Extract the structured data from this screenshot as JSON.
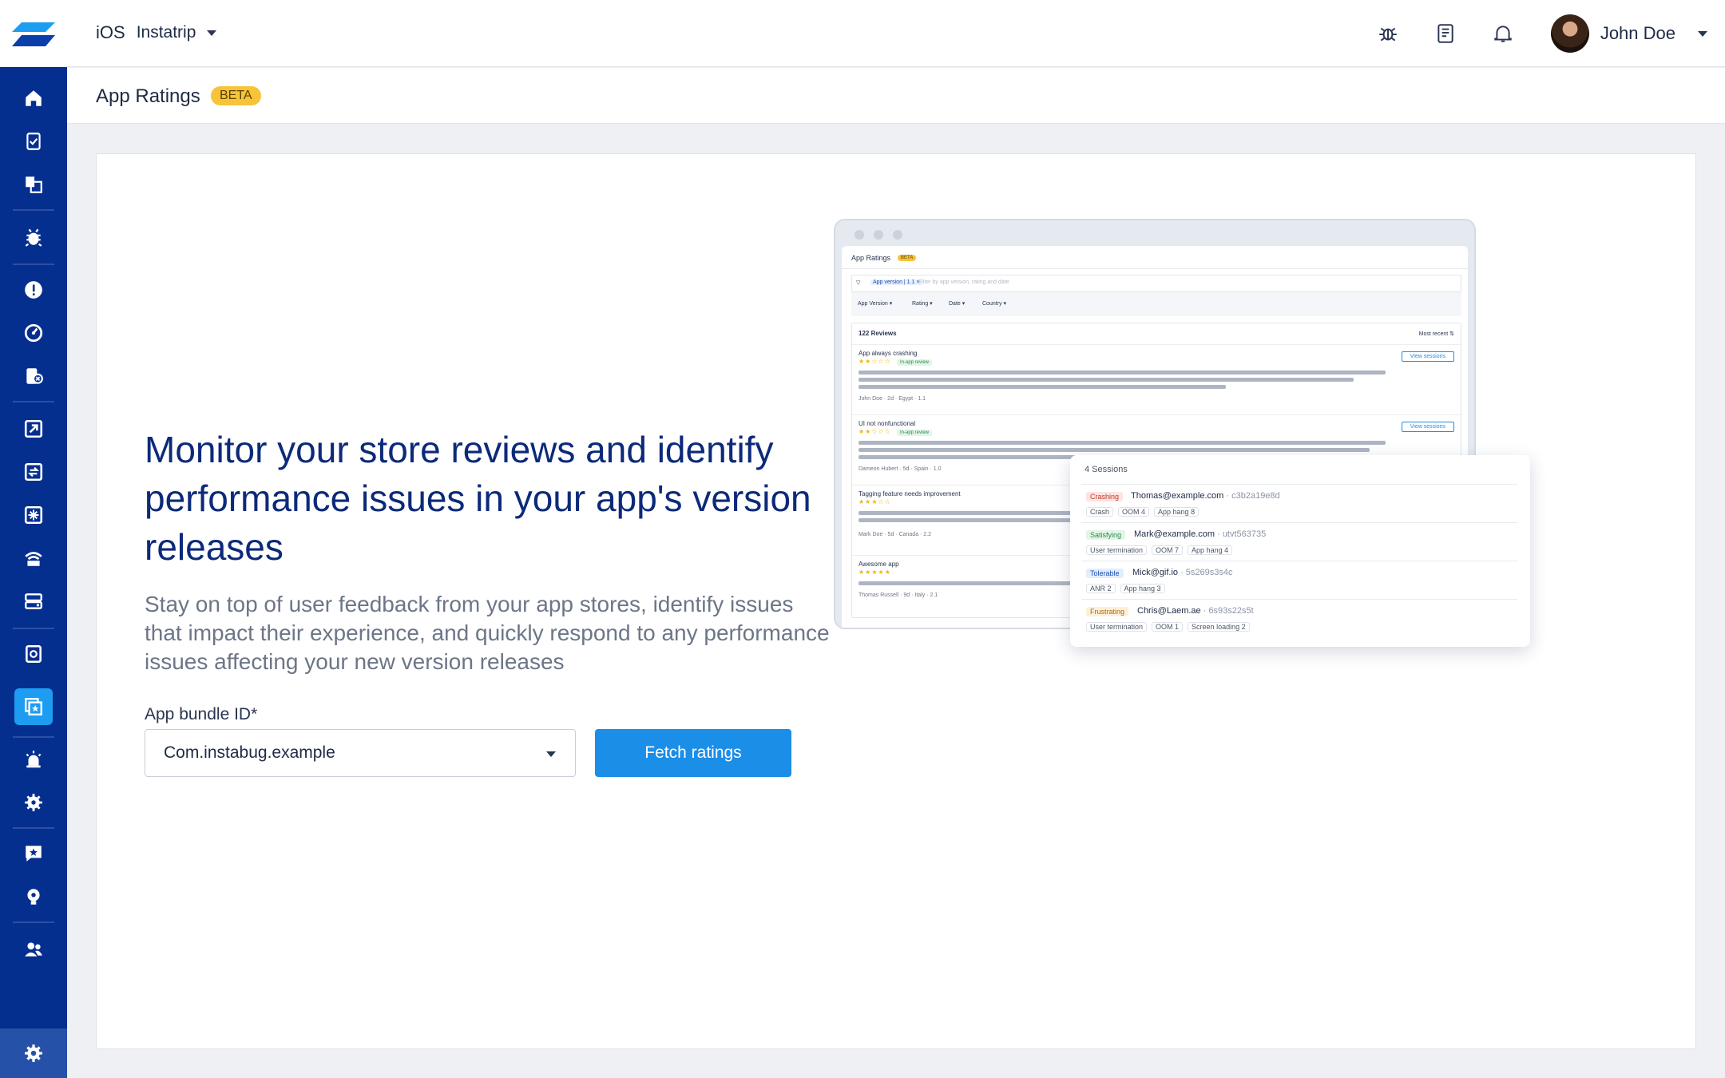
{
  "topbar": {
    "platform": "iOS",
    "app_name": "Instatrip",
    "user_name": "John Doe"
  },
  "page": {
    "title": "App Ratings",
    "badge": "BETA"
  },
  "hero": {
    "headline": "Monitor your store reviews and identify performance issues in your app's version releases",
    "subline": "Stay on top of user feedback from your app stores, identify issues that impact their experience, and quickly respond to any performance issues affecting your new version releases",
    "field_label": "App bundle ID*",
    "bundle_value": "Com.instabug.example",
    "button_label": "Fetch ratings"
  },
  "mock": {
    "title": "App Ratings",
    "badge": "BETA",
    "filter_chip": "App version | 1.1 ×",
    "filter_placeholder": "Filter by app version, rating and date",
    "filters": [
      "App Version ▾",
      "Rating ▾",
      "Date ▾",
      "Country ▾"
    ],
    "count": "122 Reviews",
    "sort": "Most recent ⇅",
    "view_sessions": "View sessions",
    "reviews": [
      {
        "title": "App always crashing",
        "stars": "★★☆☆☆",
        "tag": "In-app review",
        "meta": "John Doe · 2d · Egypt · 1.1"
      },
      {
        "title": "UI not nonfunctional",
        "stars": "★★☆☆☆",
        "tag": "In-app review",
        "meta": "Dameon Hubert · 5d · Spain · 1.0"
      },
      {
        "title": "Tagging feature needs improvement",
        "stars": "★★★☆☆",
        "meta": "Mark Doe · 5d · Canada · 2.2"
      },
      {
        "title": "Awesome app",
        "stars": "★★★★★",
        "meta": "Thomas Russell · 9d · Italy · 2.1"
      }
    ],
    "sessions_title": "4 Sessions",
    "sessions": [
      {
        "tag": "Crashing",
        "email": "Thomas@example.com",
        "id": "· c3b2a19e8d",
        "meta": [
          "Crash",
          "OOM 4",
          "App hang 8"
        ]
      },
      {
        "tag": "Satisfying",
        "email": "Mark@example.com",
        "id": "· utvt563735",
        "meta": [
          "User termination",
          "OOM 7",
          "App hang 4"
        ]
      },
      {
        "tag": "Tolerable",
        "email": "Mick@gif.io",
        "id": "· 5s269s3s4c",
        "meta": [
          "ANR 2",
          "App hang 3"
        ]
      },
      {
        "tag": "Frustrating",
        "email": "Chris@Laem.ae",
        "id": "· 6s93s22s5t",
        "meta": [
          "User termination",
          "OOM 1",
          "Screen loading 2"
        ]
      }
    ]
  },
  "colors": {
    "sidebar": "#052f8f",
    "accent": "#1b8ee8",
    "beta": "#f7c338",
    "headline": "#0c2a7a"
  }
}
